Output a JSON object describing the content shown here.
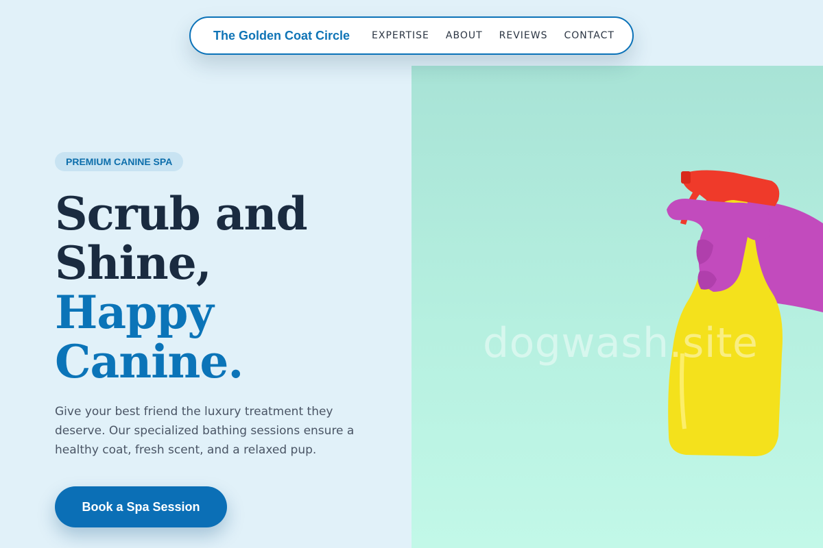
{
  "nav": {
    "brand": "The Golden Coat Circle",
    "links": [
      "EXPERTISE",
      "ABOUT",
      "REVIEWS",
      "CONTACT"
    ]
  },
  "hero": {
    "badge": "PREMIUM CANINE SPA",
    "headline_dark": [
      "Scrub and",
      "Shine,"
    ],
    "headline_accent": [
      "Happy",
      "Canine."
    ],
    "description": "Give your best friend the luxury treatment they deserve. Our specialized bathing sessions ensure a healthy coat, fresh scent, and a relaxed pup.",
    "cta_label": "Book a Spa Session",
    "watermark": "dogwash.site"
  },
  "colors": {
    "accent": "#0b72b8",
    "headline_dark": "#1a2b40",
    "background": "#e1f1f9",
    "image_bg": "#b6f0e0",
    "bottle": "#f5e21a",
    "trigger": "#ef3a2a",
    "glove": "#c24bbd"
  },
  "image": {
    "subject": "hand-in-glove-holding-spray-bottle"
  }
}
